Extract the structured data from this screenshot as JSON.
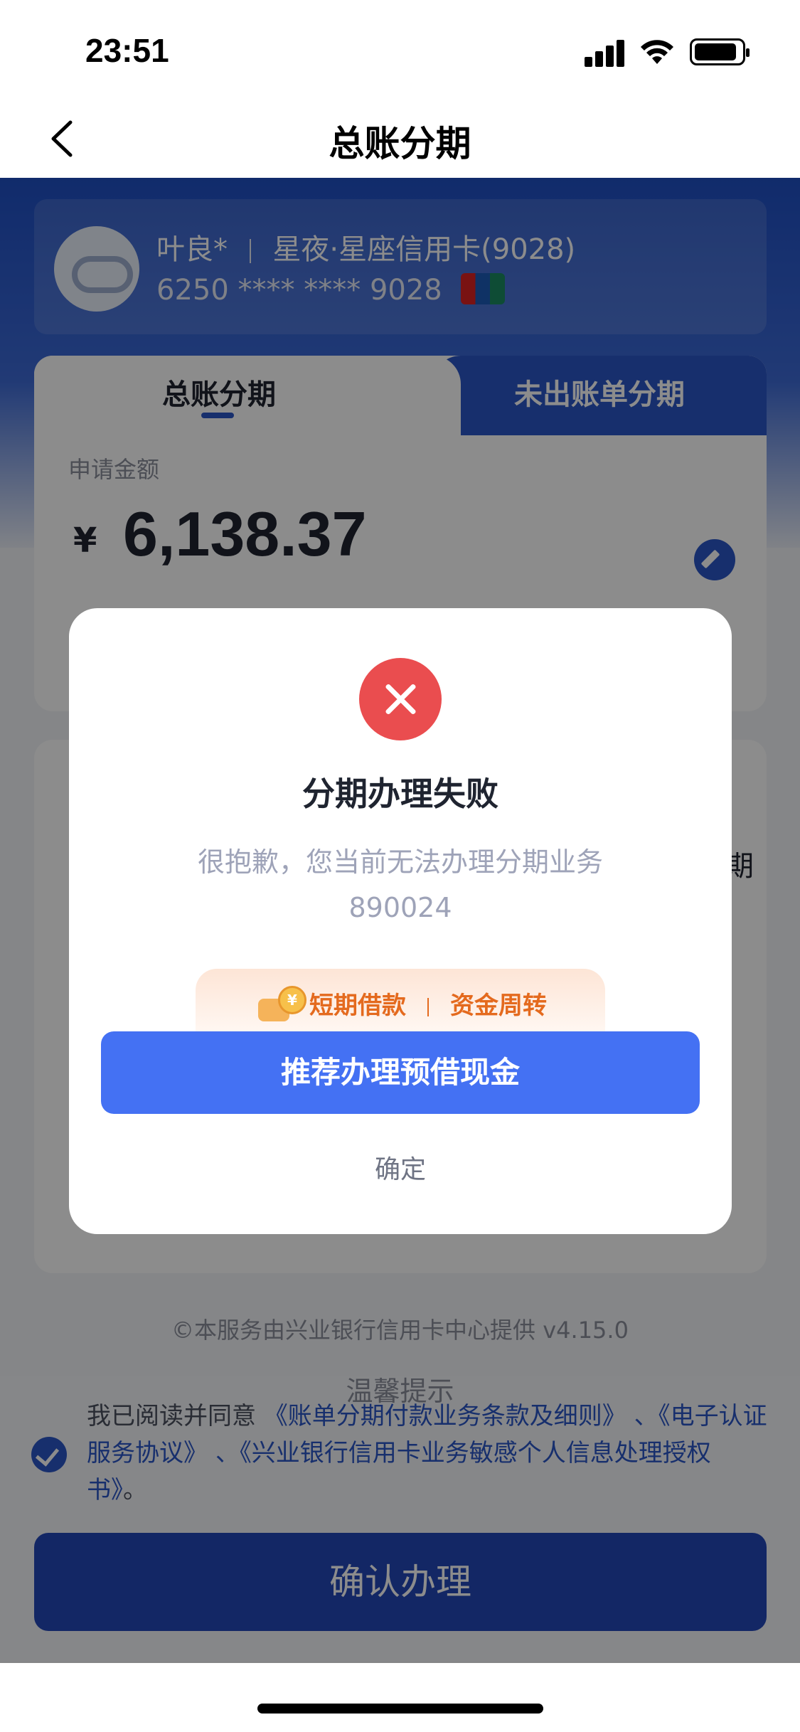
{
  "status_bar": {
    "time": "23:51"
  },
  "nav": {
    "title": "总账分期"
  },
  "card": {
    "holder_name": "叶良*",
    "card_name": "星夜·星座信用卡(9028)",
    "card_number": "6250 **** **** 9028"
  },
  "tabs": [
    {
      "label": "总账分期",
      "active": true
    },
    {
      "label": "未出账单分期",
      "active": false
    }
  ],
  "amount": {
    "label": "申请金额",
    "currency": "¥",
    "value": "6,138.37"
  },
  "period_partial_label": "期",
  "footer": {
    "credit": "©本服务由兴业银行信用卡中心提供 v4.15.0",
    "tip_title": "温馨提示"
  },
  "agreement": {
    "prefix": "我已阅读并同意",
    "link1": "《账单分期付款业务条款及细则》",
    "sep1": "、",
    "link2": "《电子认证服务协议》",
    "sep2": "、",
    "link3": "《兴业银行信用卡业务敏感个人信息处理授权书》",
    "suffix": "。",
    "checked": true
  },
  "confirm_button": {
    "label": "确认办理"
  },
  "dialog": {
    "title": "分期办理失败",
    "message": "很抱歉，您当前无法办理分期业务",
    "code": "890024",
    "promo": {
      "coin_symbol": "¥",
      "item1": "短期借款",
      "item2": "资金周转"
    },
    "primary_label": "推荐办理预借现金",
    "secondary_label": "确定"
  },
  "colors": {
    "brand_blue": "#2a56c6",
    "error_red": "#ea4d4f",
    "primary_button": "#4471f3",
    "promo_orange": "#e46a1e"
  }
}
